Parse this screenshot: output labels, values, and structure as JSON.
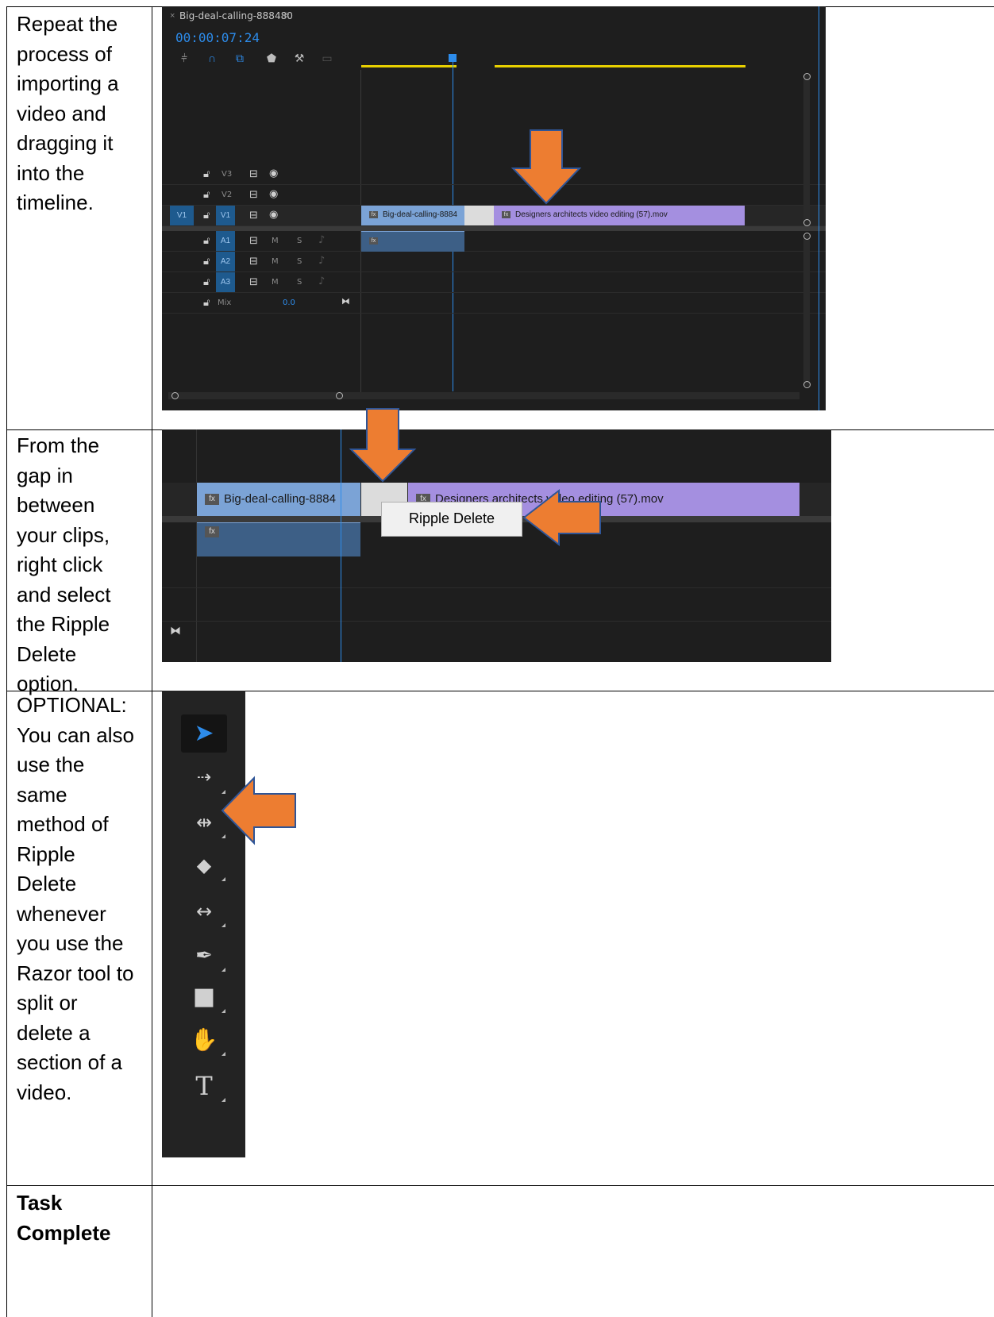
{
  "rows": [
    {
      "instruction": "Repeat the process of importing a video and dragging it into the timeline."
    },
    {
      "instruction": "From the gap in between your clips, right click and select the Ripple Delete option."
    },
    {
      "instruction": "OPTIONAL: You can also use the same method of Ripple Delete whenever you use the Razor tool to split or delete a section of a video."
    },
    {
      "instruction": "Task Complete"
    }
  ],
  "row_lines": {
    "r1": [
      "Repeat the",
      "process of",
      "importing a",
      "video and",
      "dragging it",
      "into the",
      "timeline."
    ],
    "r2": [
      "From the",
      "gap in",
      "between",
      "your clips,",
      "right click",
      "and select",
      "the Ripple",
      "Delete",
      "option."
    ],
    "r3": [
      "OPTIONAL:",
      "You can also",
      "use the",
      "same",
      "method of",
      "Ripple",
      "Delete",
      "whenever",
      "you use the",
      "Razor tool to",
      "split or",
      "delete a",
      "section of a",
      "video."
    ],
    "r4": [
      "Task",
      "Complete"
    ]
  },
  "timeline": {
    "sequence_name": "Big-deal-calling-888480",
    "close": "×",
    "menu": "≡",
    "timecode": "00:00:07:24",
    "tracks_video": [
      "V3",
      "V2",
      "V1"
    ],
    "tracks_audio": [
      "A1",
      "A2",
      "A3"
    ],
    "source_patch": "V1",
    "audio_m": "M",
    "audio_s": "S",
    "mix_label": "Mix",
    "mix_value": "0.0",
    "clip1": "Big-deal-calling-8884",
    "clip2": "Designers architects video editing (57).mov",
    "fx": "fx"
  },
  "zoom_view": {
    "clip1": "Big-deal-calling-8884",
    "clip2": "Designers architects video editing (57).mov",
    "context_menu_item": "Ripple Delete"
  },
  "tools": [
    "selection-tool",
    "track-select-forward-tool",
    "ripple-edit-tool",
    "razor-tool",
    "slip-tool",
    "pen-tool",
    "rectangle-tool",
    "hand-tool",
    "type-tool"
  ],
  "colors": {
    "accent_blue": "#2d8ceb",
    "clip_blue": "#7ba3d6",
    "clip_purple": "#a48fe0",
    "arrow_orange": "#ed7d31",
    "panel_bg": "#1e1e1e"
  }
}
